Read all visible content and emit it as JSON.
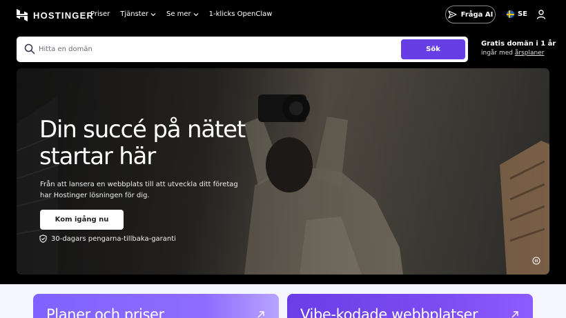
{
  "header": {
    "logo_text": "HOSTINGER",
    "nav": [
      {
        "label": "Priser",
        "has_dropdown": false
      },
      {
        "label": "Tjänster",
        "has_dropdown": true
      },
      {
        "label": "Se mer",
        "has_dropdown": true
      },
      {
        "label": "1-klicks OpenClaw",
        "has_dropdown": false
      }
    ],
    "ask_ai_label": "Fråga AI",
    "language_label": "SE",
    "icons": {
      "ask_ai": "sparkle-send-icon",
      "language": "sweden-flag-icon",
      "account": "user-icon"
    }
  },
  "search": {
    "placeholder": "Hitta en domän",
    "value": "",
    "button_label": "Sök"
  },
  "promo": {
    "title": "Gratis domän i 1 år",
    "subtitle_prefix": "ingår med ",
    "subtitle_link": "årsplaner"
  },
  "hero": {
    "title": "Din succé på nätet startar här",
    "description": "Från att lansera en webbplats till att utveckla ditt företag har Hostinger lösningen för dig.",
    "cta_label": "Kom igång nu",
    "guarantee": "30-dagars pengarna-tillbaka-garanti"
  },
  "cards": [
    {
      "title": "Planer och priser"
    },
    {
      "title": "Vibe-kodade webbplatser"
    }
  ],
  "colors": {
    "accent": "#673de6",
    "background": "#000000",
    "bottom_background": "#f4f5ff"
  }
}
